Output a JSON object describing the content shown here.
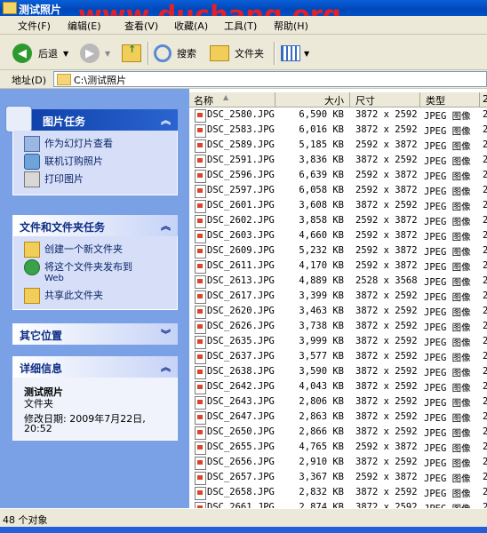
{
  "window": {
    "title": "测试照片",
    "watermark": "www.duchang.org"
  },
  "menu": [
    "文件(F)",
    "编辑(E)",
    "查看(V)",
    "收藏(A)",
    "工具(T)",
    "帮助(H)"
  ],
  "toolbar": {
    "back": "后退",
    "search": "搜索",
    "folders": "文件夹"
  },
  "address": {
    "label": "地址(D)",
    "path": "C:\\测试照片"
  },
  "panels": {
    "picture_tasks": {
      "title": "图片任务",
      "items": [
        "作为幻灯片查看",
        "联机订购照片",
        "打印图片"
      ]
    },
    "file_tasks": {
      "title": "文件和文件夹任务",
      "items": [
        "创建一个新文件夹",
        "将这个文件夹发布到",
        "Web",
        "共享此文件夹"
      ]
    },
    "other_places": {
      "title": "其它位置"
    },
    "details": {
      "title": "详细信息",
      "name": "测试照片",
      "type": "文件夹",
      "modified": "修改日期: 2009年7月22日,",
      "time": "20:52"
    }
  },
  "columns": {
    "name": "名称",
    "size": "大小",
    "dims": "尺寸",
    "type": "类型",
    "extra": "2"
  },
  "files": [
    {
      "name": "DSC_2580.JPG",
      "size": "6,590 KB",
      "dims": "3872 x 2592",
      "type": "JPEG 图像",
      "extra": "2"
    },
    {
      "name": "DSC_2583.JPG",
      "size": "6,016 KB",
      "dims": "3872 x 2592",
      "type": "JPEG 图像",
      "extra": "2"
    },
    {
      "name": "DSC_2589.JPG",
      "size": "5,185 KB",
      "dims": "2592 x 3872",
      "type": "JPEG 图像",
      "extra": "2"
    },
    {
      "name": "DSC_2591.JPG",
      "size": "3,836 KB",
      "dims": "3872 x 2592",
      "type": "JPEG 图像",
      "extra": "2"
    },
    {
      "name": "DSC_2596.JPG",
      "size": "6,639 KB",
      "dims": "2592 x 3872",
      "type": "JPEG 图像",
      "extra": "2"
    },
    {
      "name": "DSC_2597.JPG",
      "size": "6,058 KB",
      "dims": "2592 x 3872",
      "type": "JPEG 图像",
      "extra": "2"
    },
    {
      "name": "DSC_2601.JPG",
      "size": "3,608 KB",
      "dims": "3872 x 2592",
      "type": "JPEG 图像",
      "extra": "2"
    },
    {
      "name": "DSC_2602.JPG",
      "size": "3,858 KB",
      "dims": "2592 x 3872",
      "type": "JPEG 图像",
      "extra": "2"
    },
    {
      "name": "DSC_2603.JPG",
      "size": "4,660 KB",
      "dims": "2592 x 3872",
      "type": "JPEG 图像",
      "extra": "2"
    },
    {
      "name": "DSC_2609.JPG",
      "size": "5,232 KB",
      "dims": "2592 x 3872",
      "type": "JPEG 图像",
      "extra": "2"
    },
    {
      "name": "DSC_2611.JPG",
      "size": "4,170 KB",
      "dims": "2592 x 3872",
      "type": "JPEG 图像",
      "extra": "2"
    },
    {
      "name": "DSC_2613.JPG",
      "size": "4,889 KB",
      "dims": "2528 x 3568",
      "type": "JPEG 图像",
      "extra": "2"
    },
    {
      "name": "DSC_2617.JPG",
      "size": "3,399 KB",
      "dims": "3872 x 2592",
      "type": "JPEG 图像",
      "extra": "2"
    },
    {
      "name": "DSC_2620.JPG",
      "size": "3,463 KB",
      "dims": "3872 x 2592",
      "type": "JPEG 图像",
      "extra": "2"
    },
    {
      "name": "DSC_2626.JPG",
      "size": "3,738 KB",
      "dims": "3872 x 2592",
      "type": "JPEG 图像",
      "extra": "2"
    },
    {
      "name": "DSC_2635.JPG",
      "size": "3,999 KB",
      "dims": "3872 x 2592",
      "type": "JPEG 图像",
      "extra": "2"
    },
    {
      "name": "DSC_2637.JPG",
      "size": "3,577 KB",
      "dims": "3872 x 2592",
      "type": "JPEG 图像",
      "extra": "2"
    },
    {
      "name": "DSC_2638.JPG",
      "size": "3,590 KB",
      "dims": "3872 x 2592",
      "type": "JPEG 图像",
      "extra": "2"
    },
    {
      "name": "DSC_2642.JPG",
      "size": "4,043 KB",
      "dims": "3872 x 2592",
      "type": "JPEG 图像",
      "extra": "2"
    },
    {
      "name": "DSC_2643.JPG",
      "size": "2,806 KB",
      "dims": "3872 x 2592",
      "type": "JPEG 图像",
      "extra": "2"
    },
    {
      "name": "DSC_2647.JPG",
      "size": "2,863 KB",
      "dims": "3872 x 2592",
      "type": "JPEG 图像",
      "extra": "2"
    },
    {
      "name": "DSC_2650.JPG",
      "size": "2,866 KB",
      "dims": "3872 x 2592",
      "type": "JPEG 图像",
      "extra": "2"
    },
    {
      "name": "DSC_2655.JPG",
      "size": "4,765 KB",
      "dims": "2592 x 3872",
      "type": "JPEG 图像",
      "extra": "2"
    },
    {
      "name": "DSC_2656.JPG",
      "size": "2,910 KB",
      "dims": "3872 x 2592",
      "type": "JPEG 图像",
      "extra": "2"
    },
    {
      "name": "DSC_2657.JPG",
      "size": "3,367 KB",
      "dims": "2592 x 3872",
      "type": "JPEG 图像",
      "extra": "2"
    },
    {
      "name": "DSC_2658.JPG",
      "size": "2,832 KB",
      "dims": "3872 x 2592",
      "type": "JPEG 图像",
      "extra": "2"
    },
    {
      "name": "DSC_2661.JPG",
      "size": "2,874 KB",
      "dims": "3872 x 2592",
      "type": "JPEG 图像",
      "extra": "2"
    }
  ],
  "status": "48 个对象"
}
